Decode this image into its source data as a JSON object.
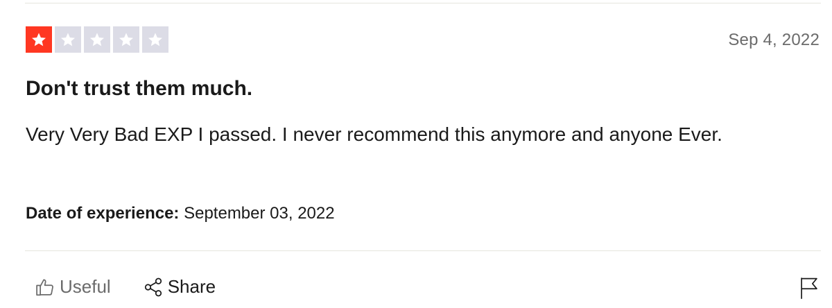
{
  "review": {
    "rating": 1,
    "rating_max": 5,
    "date": "Sep 4, 2022",
    "title": "Don't trust them much.",
    "body": "Very Very Bad EXP I passed. I never recommend this anymore and anyone Ever.",
    "experience_label": "Date of experience:",
    "experience_date": "September 03, 2022"
  },
  "actions": {
    "useful_label": "Useful",
    "share_label": "Share",
    "useful_icon": "thumbs-up-icon",
    "share_icon": "share-icon",
    "flag_icon": "flag-icon"
  },
  "colors": {
    "star_filled": "#ff3722",
    "star_empty": "#dcdce6",
    "date_text": "#6b6b6b"
  }
}
